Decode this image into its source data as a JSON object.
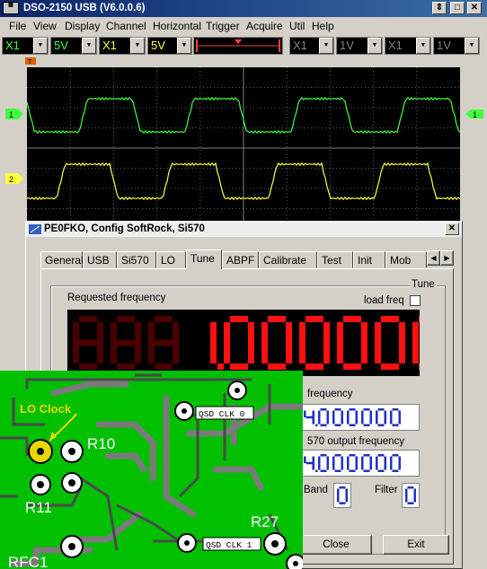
{
  "osc": {
    "title": "DSO-2150 USB (V6.0.0.6)",
    "menu": [
      "File",
      "View",
      "Display",
      "Channel",
      "Horizontal",
      "Trigger",
      "Acquire",
      "Util",
      "Help"
    ],
    "toolbar": {
      "ch1_probe": "X1",
      "ch1_volts": "5V",
      "ch2_probe": "X1",
      "ch2_volts": "5V",
      "ch3_probe": "X1",
      "ch3_volts": "1V",
      "ch4_probe": "X1",
      "ch4_volts": "1V"
    },
    "ch1_marker": "1",
    "ch2_marker": "2",
    "colors": {
      "ch1": "#40ff40",
      "ch2": "#ffff40",
      "grid": "#606060"
    }
  },
  "dialog": {
    "title": "PE0FKO, Config SoftRock, Si570",
    "tabs": [
      "General",
      "USB",
      "Si570",
      "LO",
      "Tune",
      "ABPF",
      "Calibrate",
      "Test",
      "Init",
      "Mob"
    ],
    "active_tab": "Tune",
    "group_title": "Tune",
    "requested_label": "Requested frequency",
    "load_freq_label": "load freq",
    "big_display": "888.1.000000",
    "lo_freq_label": "frequency",
    "lo_freq_value": "4.000000",
    "si570_label": "570 output frequency",
    "si570_value": "4.000000",
    "band_label": "Band",
    "band_value": "0",
    "filter_label": "Filter",
    "filter_value": "0",
    "close_label": "Close",
    "exit_label": "Exit"
  },
  "pcb": {
    "lo_clock_label": "LO Clock",
    "r10": "R10",
    "r11": "R11",
    "r27": "R27",
    "rfc1": "RFC1",
    "qsd0": "QSD CLK 0",
    "qsd1": "QSD CLK 1"
  }
}
